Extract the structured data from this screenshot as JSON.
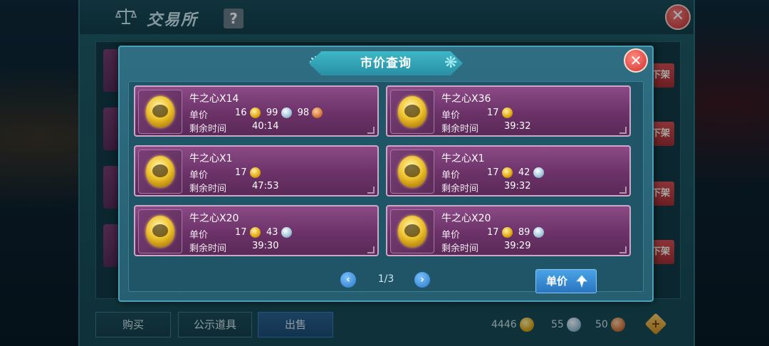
{
  "background": {
    "title": "交易所",
    "help_label": "?",
    "close_label": "✕",
    "off_shelf_label": "下架",
    "tabs": [
      {
        "label": "购买"
      },
      {
        "label": "公示道具"
      },
      {
        "label": "出售"
      }
    ],
    "currency": {
      "gold": "4446",
      "silver": "55",
      "copper": "50"
    }
  },
  "dialog": {
    "title": "市价查询",
    "close_label": "✕",
    "price_label": "单价",
    "time_label": "剩余时间",
    "listings": [
      {
        "name": "牛之心X14",
        "gold": "16",
        "silver": "99",
        "copper": "98",
        "time": "40:14"
      },
      {
        "name": "牛之心X36",
        "gold": "17",
        "silver": "",
        "copper": "",
        "time": "39:32"
      },
      {
        "name": "牛之心X1",
        "gold": "17",
        "silver": "",
        "copper": "",
        "time": "47:53"
      },
      {
        "name": "牛之心X1",
        "gold": "17",
        "silver": "42",
        "copper": "",
        "time": "39:32"
      },
      {
        "name": "牛之心X20",
        "gold": "17",
        "silver": "43",
        "copper": "",
        "time": "39:30"
      },
      {
        "name": "牛之心X20",
        "gold": "17",
        "silver": "89",
        "copper": "",
        "time": "39:29"
      }
    ],
    "pagination": {
      "prev": "‹",
      "next": "›",
      "page": "1/3"
    },
    "sort_button_label": "单价"
  },
  "colors": {
    "gold": "#e0a610",
    "silver": "#9ec4d8",
    "copper": "#d5783a",
    "card": "#6b3268",
    "accent": "#2a8fa3"
  }
}
